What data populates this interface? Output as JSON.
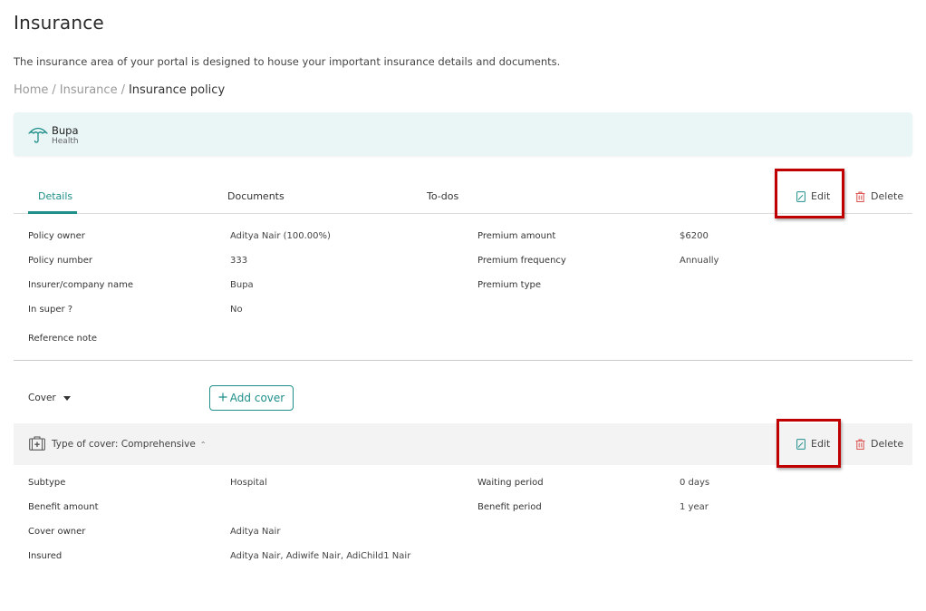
{
  "page": {
    "title": "Insurance",
    "description": "The insurance area of your portal is designed to house your important insurance details and documents."
  },
  "breadcrumb": {
    "items": [
      "Home",
      "Insurance",
      "Insurance policy"
    ],
    "separator": "/"
  },
  "provider": {
    "name": "Bupa",
    "type": "Health",
    "icon": "umbrella-icon"
  },
  "tabs": [
    "Details",
    "Documents",
    "To-dos"
  ],
  "actions": {
    "edit_label": "Edit",
    "delete_label": "Delete"
  },
  "policy": {
    "left": [
      {
        "label": "Policy owner",
        "value": "Aditya Nair (100.00%)"
      },
      {
        "label": "Policy number",
        "value": "333"
      },
      {
        "label": "Insurer/company name",
        "value": "Bupa"
      },
      {
        "label": "In super ?",
        "value": "No"
      },
      {
        "label": "Reference note",
        "value": ""
      }
    ],
    "right": [
      {
        "label": "Premium amount",
        "value": "$6200"
      },
      {
        "label": "Premium frequency",
        "value": "Annually"
      },
      {
        "label": "Premium type",
        "value": ""
      }
    ]
  },
  "cover": {
    "select_label": "Cover",
    "add_button_label": "Add cover",
    "title": "Type of cover: Comprehensive",
    "left": [
      {
        "label": "Subtype",
        "value": "Hospital"
      },
      {
        "label": "Benefit amount",
        "value": ""
      },
      {
        "label": "Cover owner",
        "value": "Aditya Nair"
      },
      {
        "label": "Insured",
        "value": "Aditya Nair, Adiwife Nair, AdiChild1 Nair"
      }
    ],
    "right": [
      {
        "label": "Waiting period",
        "value": "0 days"
      },
      {
        "label": "Benefit period",
        "value": "1 year"
      }
    ]
  },
  "colors": {
    "accent": "#1f8f8a",
    "delete": "#d9534f",
    "highlight": "#c00000",
    "card_bg": "#eaf5f5",
    "cover_bar_bg": "#f3f3f3"
  }
}
